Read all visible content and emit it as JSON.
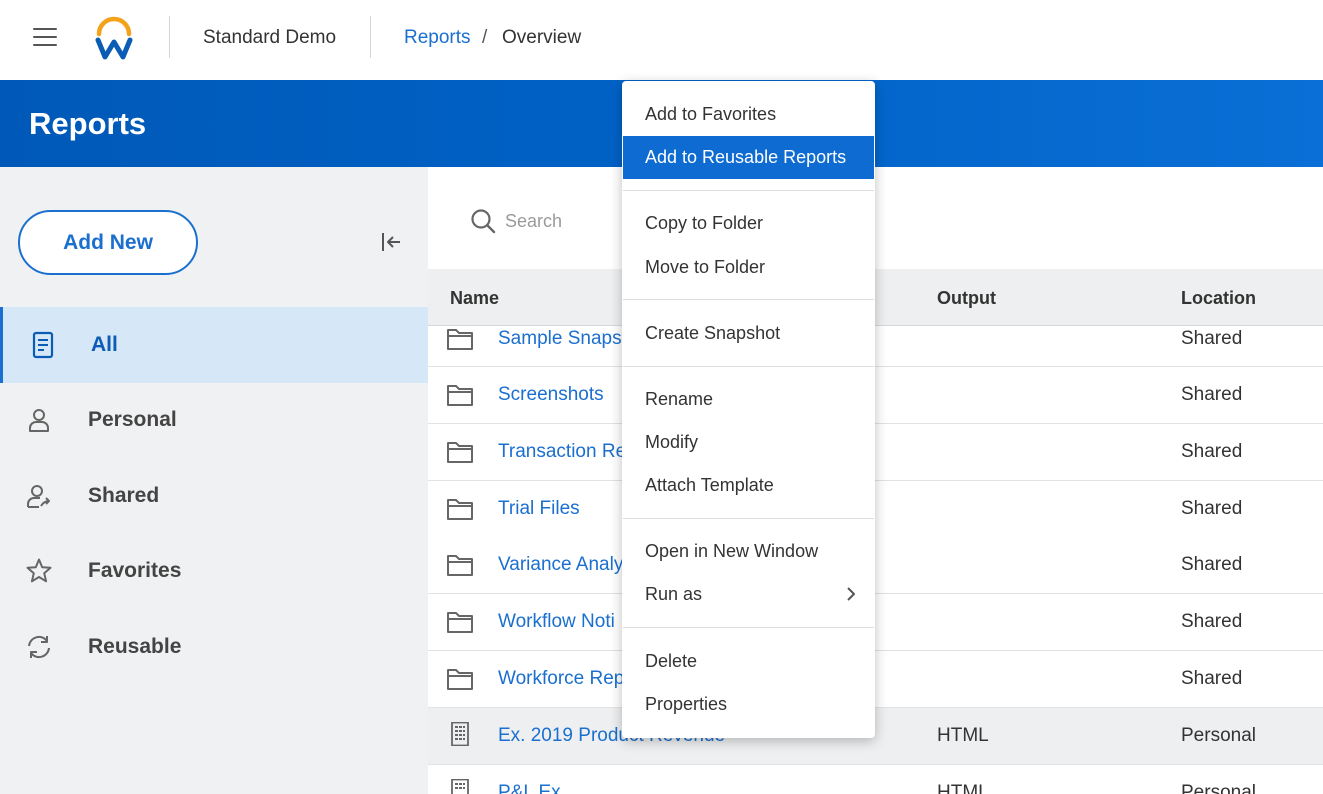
{
  "topbar": {
    "tenant_name": "Standard Demo",
    "breadcrumb": {
      "link": "Reports",
      "separator": "/",
      "current": "Overview"
    }
  },
  "header": {
    "title": "Reports"
  },
  "sidebar": {
    "add_new_label": "Add New",
    "items": [
      {
        "label": "All",
        "icon": "document-icon",
        "active": true
      },
      {
        "label": "Personal",
        "icon": "person-icon",
        "active": false
      },
      {
        "label": "Shared",
        "icon": "shared-person-icon",
        "active": false
      },
      {
        "label": "Favorites",
        "icon": "star-icon",
        "active": false
      },
      {
        "label": "Reusable",
        "icon": "refresh-icon",
        "active": false
      }
    ]
  },
  "search": {
    "placeholder": "Search"
  },
  "table": {
    "columns": {
      "name": "Name",
      "output": "Output",
      "location": "Location"
    },
    "rows": [
      {
        "type": "folder",
        "name": "Sample Snaps",
        "output": "",
        "location": "Shared"
      },
      {
        "type": "folder",
        "name": "Screenshots",
        "output": "",
        "location": "Shared"
      },
      {
        "type": "folder",
        "name": "Transaction Re",
        "output": "",
        "location": "Shared"
      },
      {
        "type": "folder",
        "name": "Trial Files",
        "output": "",
        "location": "Shared"
      },
      {
        "type": "folder",
        "name": "Variance Analy",
        "output": "",
        "location": "Shared"
      },
      {
        "type": "folder",
        "name": "Workflow Noti",
        "output": "",
        "location": "Shared"
      },
      {
        "type": "folder",
        "name": "Workforce Rep",
        "output": "",
        "location": "Shared"
      },
      {
        "type": "report",
        "name": "Ex. 2019 Product Revenue",
        "output": "HTML",
        "location": "Personal"
      },
      {
        "type": "report",
        "name": "P&L Ex",
        "output": "HTML",
        "location": "Personal"
      }
    ]
  },
  "context_menu": {
    "groups": [
      [
        "Add to Favorites",
        "Add to Reusable Reports"
      ],
      [
        "Copy to Folder",
        "Move to Folder"
      ],
      [
        "Create Snapshot"
      ],
      [
        "Rename",
        "Modify",
        "Attach Template"
      ],
      [
        "Open in New Window",
        "Run as"
      ],
      [
        "Delete",
        "Properties"
      ]
    ],
    "highlighted": "Add to Reusable Reports",
    "submenu_item": "Run as"
  },
  "colors": {
    "brand_blue": "#0062c6",
    "link_blue": "#1a6fcf",
    "logo_orange": "#f5a21b",
    "highlight": "#0d6bd1"
  }
}
